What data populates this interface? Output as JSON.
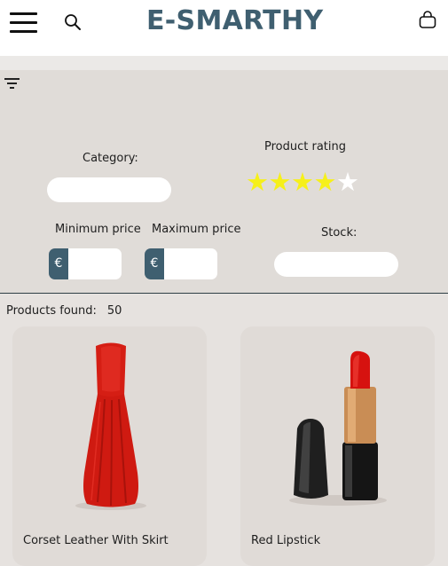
{
  "header": {
    "brand": "E-SMARTHY",
    "icons": {
      "menu": "hamburger-menu-icon",
      "search": "search-icon",
      "cart": "shopping-bag-icon"
    }
  },
  "filters": {
    "category_label": "Category:",
    "category_value": "",
    "rating_label": "Product rating",
    "rating": {
      "value": 4,
      "max": 5
    },
    "min_price_label": "Minimum price",
    "max_price_label": "Maximum price",
    "currency_symbol": "€",
    "min_price_value": "",
    "max_price_value": "",
    "stock_label": "Stock:",
    "stock_value": ""
  },
  "results": {
    "label": "Products found:",
    "count": "50"
  },
  "products": [
    {
      "name": "Corset Leather With Skirt",
      "image": "red-dress-image"
    },
    {
      "name": "Red Lipstick",
      "image": "red-lipstick-image"
    }
  ],
  "colors": {
    "brand": "#3f5f70",
    "star_on": "#f6f01a",
    "star_off": "#ffffff",
    "panel": "#e0dcd8"
  }
}
